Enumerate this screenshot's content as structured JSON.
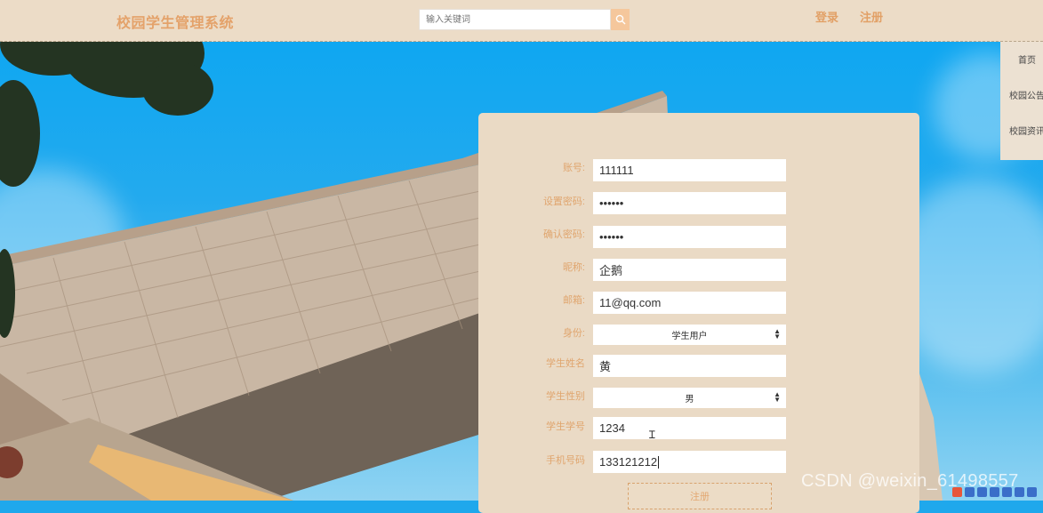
{
  "header": {
    "brand": "校园学生管理系统",
    "search": {
      "placeholder": "输入关键词",
      "value": ""
    },
    "login_label": "登录",
    "register_label": "注册"
  },
  "side_menu": {
    "items": [
      {
        "label": "首页"
      },
      {
        "label": "校园公告"
      },
      {
        "label": "校园资讯"
      }
    ]
  },
  "form": {
    "fields": [
      {
        "label": "账号:",
        "value": "111111"
      },
      {
        "label": "设置密码:",
        "value": "••••••"
      },
      {
        "label": "确认密码:",
        "value": "••••••"
      },
      {
        "label": "昵称:",
        "value": "企鹅"
      },
      {
        "label": "邮箱:",
        "value": "11@qq.com"
      },
      {
        "label": "身份:",
        "value": "学生用户"
      },
      {
        "label": "学生姓名",
        "value": "黄"
      },
      {
        "label": "学生性别",
        "value": "男"
      },
      {
        "label": "学生学号",
        "value": "1234"
      },
      {
        "label": "手机号码",
        "value": "133121212"
      }
    ],
    "submit_label": "注册"
  },
  "watermark": "CSDN @weixin_61498557",
  "colors": {
    "header_bg": "#ecdcc7",
    "accent": "#e4a26a",
    "panel_bg": "#eadac5",
    "search_button": "#f5c79c"
  },
  "icons": {
    "search": "search-icon",
    "select_arrow": "updown-arrow-icon",
    "text_cursor": "ibeam-cursor-icon"
  }
}
